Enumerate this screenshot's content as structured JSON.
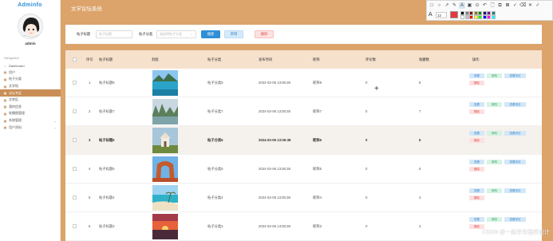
{
  "app": {
    "brand": "Adminfo",
    "user": "admin",
    "system_title": "文学论坛系统"
  },
  "sidebar": {
    "section_label": "Navigation",
    "items": [
      {
        "label": "Dashboard",
        "icon": "circle-icon",
        "active": false,
        "expandable": false
      },
      {
        "label": "用户",
        "icon": "grid-icon",
        "active": false,
        "expandable": false
      },
      {
        "label": "帖子分类",
        "icon": "grid-icon",
        "active": false,
        "expandable": false
      },
      {
        "label": "文学帖",
        "icon": "grid-icon",
        "active": false,
        "expandable": false
      },
      {
        "label": "论坛专区",
        "icon": "grid-icon",
        "active": true,
        "expandable": false
      },
      {
        "label": "文库区",
        "icon": "grid-icon",
        "active": false,
        "expandable": false
      },
      {
        "label": "我的信息",
        "icon": "grid-icon",
        "active": false,
        "expandable": false
      },
      {
        "label": "轮播图管理",
        "icon": "grid-icon",
        "active": false,
        "expandable": false
      },
      {
        "label": "系统管理",
        "icon": "grid-icon",
        "active": false,
        "expandable": true
      },
      {
        "label": "用户资料",
        "icon": "grid-icon",
        "active": false,
        "expandable": true
      }
    ]
  },
  "screenshot_toolbar": {
    "tools": [
      "□",
      "○",
      "↗",
      "✎",
      "A",
      "▣",
      "⊙",
      "↶",
      "🗋",
      "⧉",
      "⊠",
      "✓",
      "⌫",
      "✕",
      "✓"
    ],
    "font_size": "12",
    "current_color": "#e8393a",
    "palette": [
      "#000000",
      "#808080",
      "#800000",
      "#808000",
      "#008000",
      "#000080",
      "#800080",
      "#008080",
      "#ffffff",
      "#c0c0c0",
      "#ff0000",
      "#ffff00",
      "#00ff00",
      "#0000ff",
      "#ff00ff",
      "#00ffff"
    ]
  },
  "filters": {
    "title_label": "帖子标题",
    "title_placeholder": "帖子标题",
    "category_label": "帖子分类",
    "category_placeholder": "请选择帖子分类",
    "search_button": "搜索",
    "add_button": "新增",
    "delete_button": "删除"
  },
  "table": {
    "columns": [
      "序号",
      "帖子标题",
      "封面",
      "帖子分类",
      "发布时间",
      "昵称",
      "评论数",
      "收藏数",
      "操作"
    ],
    "rows": [
      {
        "index": "1",
        "title": "帖子标题8",
        "category": "帖子分类8",
        "time": "2024-02-06 13:05:38",
        "nickname": "昵称8",
        "comments": "0",
        "favorites": "8",
        "image": "lake",
        "hover": false
      },
      {
        "index": "2",
        "title": "帖子标题7",
        "category": "帖子分类7",
        "time": "2024-02-06 13:05:38",
        "nickname": "昵称7",
        "comments": "0",
        "favorites": "7",
        "image": "karst",
        "hover": false
      },
      {
        "index": "3",
        "title": "帖子标题6",
        "category": "帖子分类6",
        "time": "2024-02-06 13:05:38",
        "nickname": "昵称6",
        "comments": "0",
        "favorites": "6",
        "image": "temple",
        "hover": true
      },
      {
        "index": "4",
        "title": "帖子标题5",
        "category": "帖子分类5",
        "time": "2024-02-06 13:05:38",
        "nickname": "昵称5",
        "comments": "0",
        "favorites": "5",
        "image": "arch",
        "hover": false
      },
      {
        "index": "5",
        "title": "帖子标题4",
        "category": "帖子分类4",
        "time": "2024-02-06 13:05:38",
        "nickname": "昵称4",
        "comments": "0",
        "favorites": "4",
        "image": "beach",
        "hover": false
      },
      {
        "index": "6",
        "title": "帖子标题3",
        "category": "帖子分类3",
        "time": "2024-02-06 13:05:38",
        "nickname": "昵称3",
        "comments": "0",
        "favorites": "3",
        "image": "sunset",
        "hover": false
      }
    ],
    "actions": {
      "view": "查看",
      "edit": "修改",
      "review": "查看评论",
      "delete": "删除"
    }
  },
  "watermark": "CSDN @一起学长程序设计"
}
